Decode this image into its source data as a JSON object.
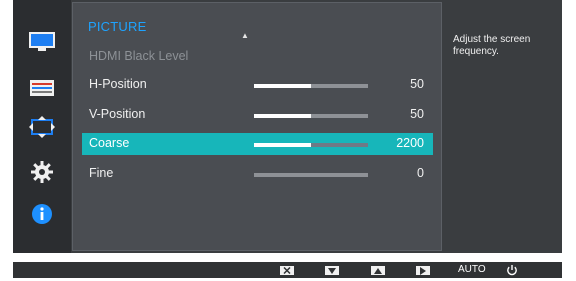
{
  "menu": {
    "title": "PICTURE",
    "items": [
      {
        "label": "HDMI Black Level",
        "disabled": true
      },
      {
        "label": "H-Position",
        "value": "50",
        "fraction": 0.5
      },
      {
        "label": "V-Position",
        "value": "50",
        "fraction": 0.5
      },
      {
        "label": "Coarse",
        "value": "2200",
        "fraction": 0.5,
        "selected": true
      },
      {
        "label": "Fine",
        "value": "0",
        "fraction": 0.0
      }
    ]
  },
  "help_text": "Adjust the screen frequency.",
  "sidebar": {
    "items": [
      {
        "icon": "monitor-picture-icon",
        "active": true
      },
      {
        "icon": "onscreen-display-icon"
      },
      {
        "icon": "position-move-icon"
      },
      {
        "icon": "settings-gear-icon"
      },
      {
        "icon": "information-icon"
      }
    ]
  },
  "bottom_bar": {
    "buttons": [
      {
        "icon": "close-x-icon"
      },
      {
        "icon": "arrow-down-icon"
      },
      {
        "icon": "arrow-up-icon"
      },
      {
        "icon": "arrow-right-icon"
      },
      {
        "label": "AUTO"
      },
      {
        "icon": "power-icon"
      }
    ]
  },
  "colors": {
    "title_accent": "#1ea3ff",
    "selected_row": "#17b6ba",
    "info_blue": "#1e90ff"
  }
}
